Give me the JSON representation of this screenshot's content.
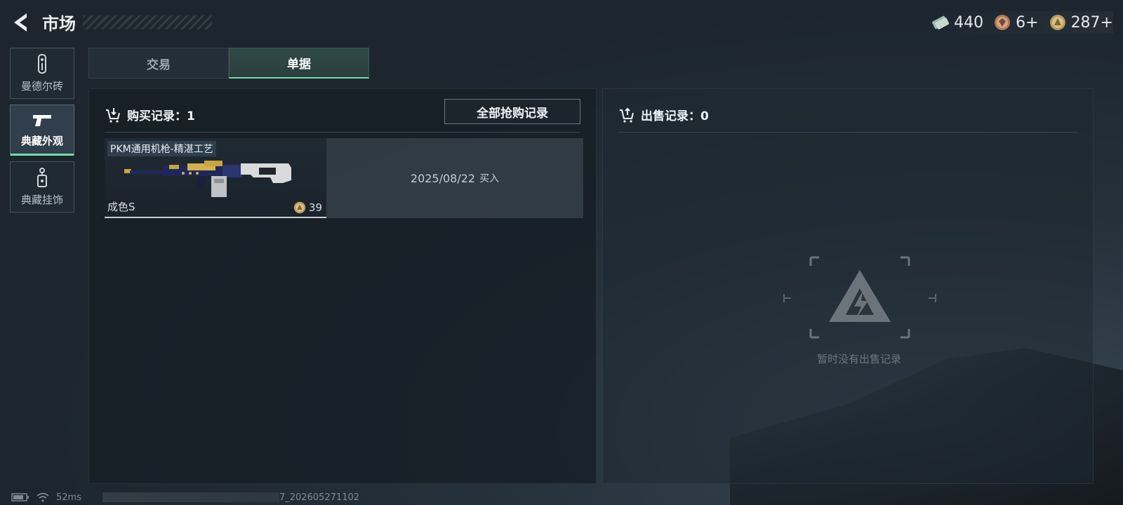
{
  "header": {
    "title": "市场",
    "currencies": [
      {
        "icon": "cash-icon",
        "value": "440"
      },
      {
        "icon": "gem-icon",
        "value": "6+"
      },
      {
        "icon": "coin-icon",
        "value": "287+"
      }
    ]
  },
  "sidebar": {
    "items": [
      {
        "label": "曼德尔砖",
        "icon": "brick-icon",
        "active": false
      },
      {
        "label": "典藏外观",
        "icon": "pistol-icon",
        "active": true
      },
      {
        "label": "典藏挂饰",
        "icon": "charm-icon",
        "active": false
      }
    ]
  },
  "tabs": [
    {
      "label": "交易",
      "active": false
    },
    {
      "label": "单据",
      "active": true
    }
  ],
  "purchase": {
    "title": "购买记录：1",
    "all_records_button": "全部抢购记录",
    "records": [
      {
        "item_name": "PKM通用机枪-精湛工艺",
        "grade": "成色S",
        "price": "39",
        "date": "2025/08/22",
        "action": "买入"
      }
    ]
  },
  "sale": {
    "title": "出售记录：0",
    "empty_text": "暂时没有出售记录"
  },
  "footer": {
    "ping": "52ms",
    "build": "7_202605271102"
  },
  "colors": {
    "accent": "#6ee0a6",
    "background": "#1d262e"
  }
}
